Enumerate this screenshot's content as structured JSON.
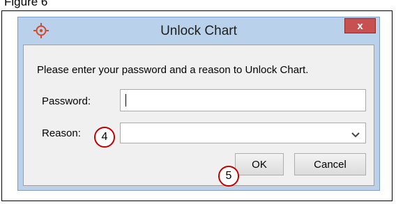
{
  "document": {
    "caption": "Figure 6"
  },
  "dialog": {
    "title": "Unlock Chart",
    "close_label": "x",
    "message": "Please enter your password and a reason to Unlock Chart.",
    "password": {
      "label": "Password:",
      "value": ""
    },
    "reason": {
      "label": "Reason:",
      "value": ""
    },
    "buttons": {
      "ok": "OK",
      "cancel": "Cancel"
    },
    "icons": {
      "app": "crosshair-target-icon",
      "dropdown": "chevron-down-icon"
    },
    "colors": {
      "frame": "#b9d1ea",
      "close": "#c75050",
      "callout": "#c00000"
    }
  },
  "callouts": [
    "4",
    "5"
  ]
}
